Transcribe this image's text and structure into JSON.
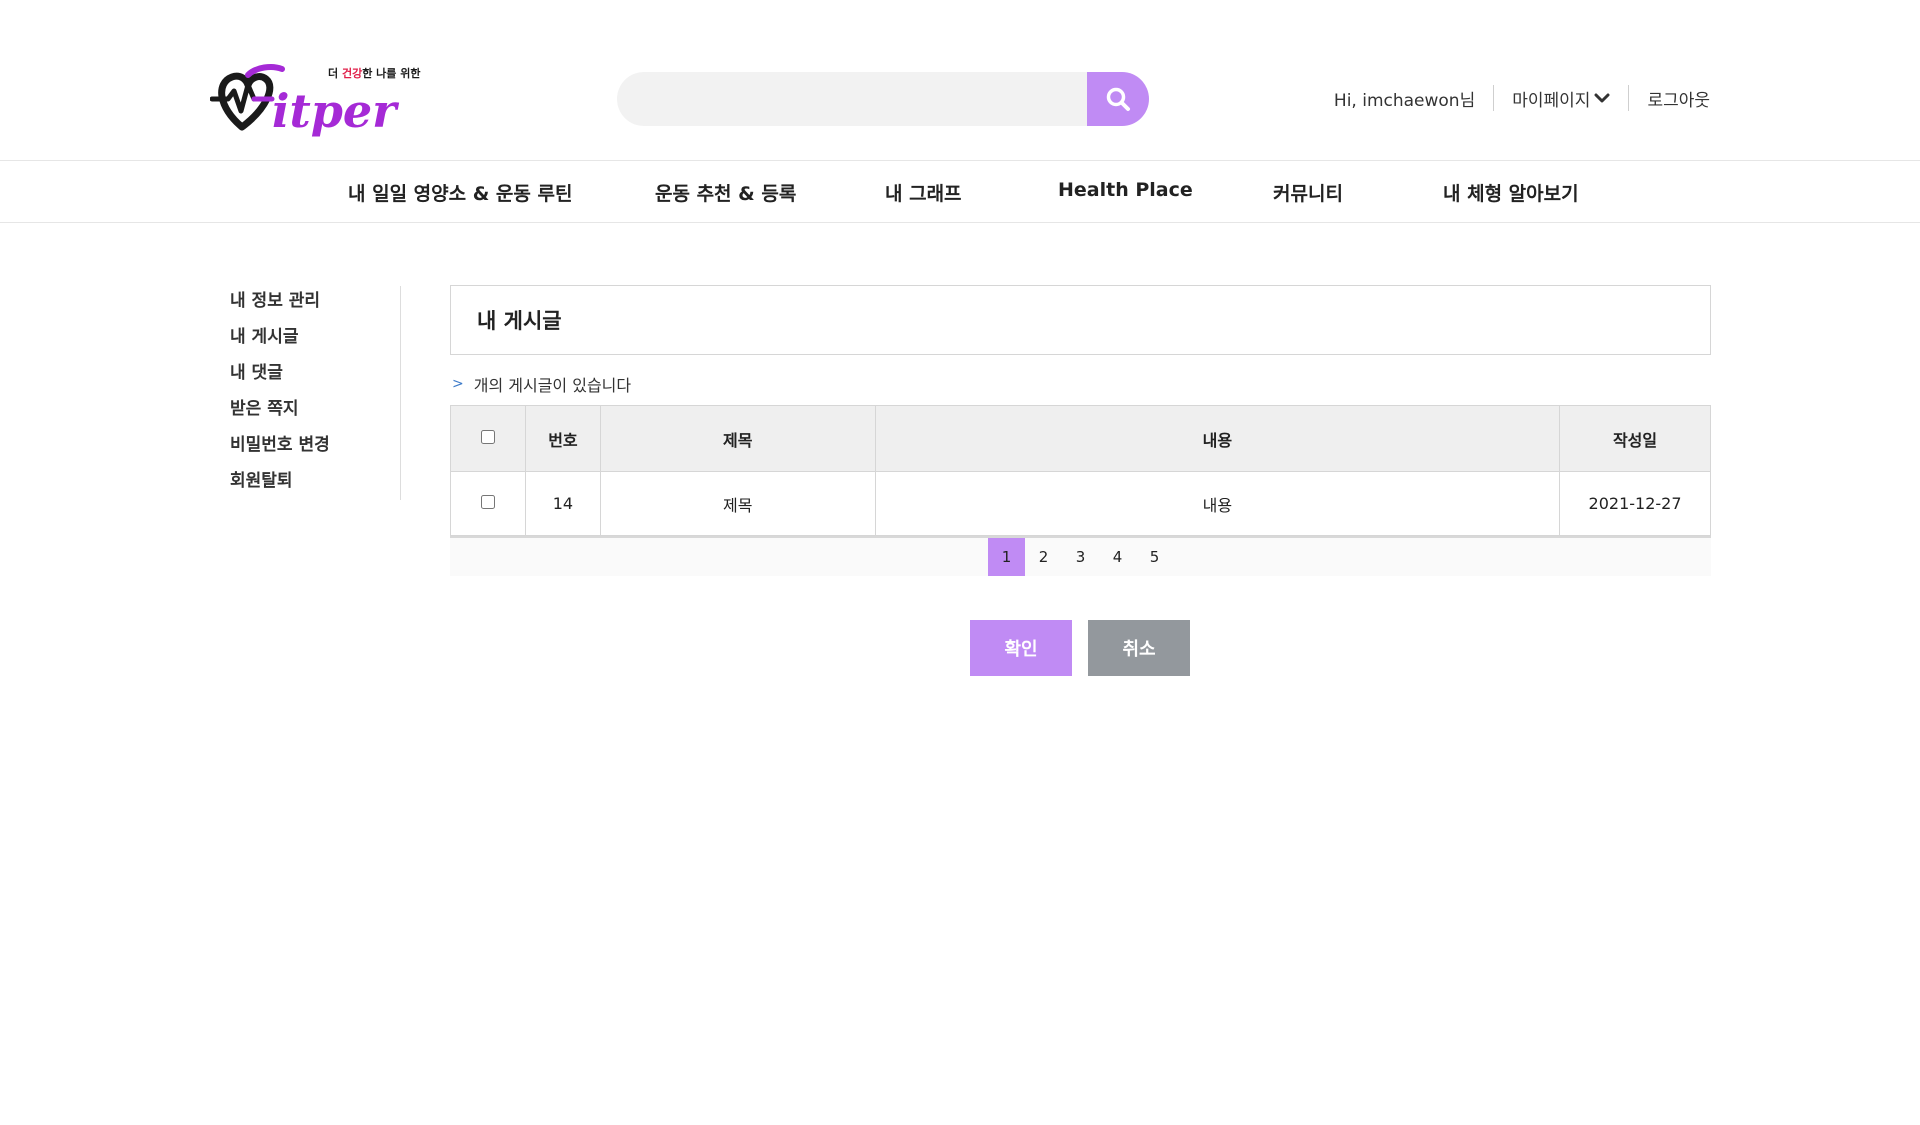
{
  "brand": {
    "logo_word": "Fitper",
    "tagline": "더 건강한 나를 위한",
    "colors": {
      "primary": "#c08bf4",
      "logo_dark": "#1a1a1a",
      "logo_purple": "#a52ad6",
      "tagline_red": "#e0204a"
    }
  },
  "search": {
    "placeholder": "",
    "value": "",
    "icon": "search-icon"
  },
  "user": {
    "greeting": "Hi, imchaewon님",
    "mypage_label": "마이페이지",
    "logout_label": "로그아웃"
  },
  "gnb": [
    {
      "label": "내 일일 영양소 & 운동 루틴"
    },
    {
      "label": "운동 추천 & 등록"
    },
    {
      "label": "내 그래프"
    },
    {
      "label": "Health Place"
    },
    {
      "label": "커뮤니티"
    },
    {
      "label": "내 체형 알아보기"
    }
  ],
  "sidebar": [
    {
      "label": "내 정보 관리"
    },
    {
      "label": "내 게시글"
    },
    {
      "label": "내 댓글"
    },
    {
      "label": "받은 쪽지"
    },
    {
      "label": "비밀번호 변경"
    },
    {
      "label": "회원탈퇴"
    }
  ],
  "main": {
    "title": "내 게시글",
    "count_text": "개의 게시글이 있습니다",
    "table": {
      "headers": {
        "no": "번호",
        "title": "제목",
        "content": "내용",
        "date": "작성일"
      },
      "rows": [
        {
          "no": "14",
          "title": "제목",
          "content": "내용",
          "date": "2021-12-27",
          "checked": false
        }
      ]
    },
    "pagination": [
      "1",
      "2",
      "3",
      "4",
      "5"
    ],
    "current_page": "1"
  },
  "actions": {
    "confirm_label": "확인",
    "cancel_label": "취소"
  }
}
